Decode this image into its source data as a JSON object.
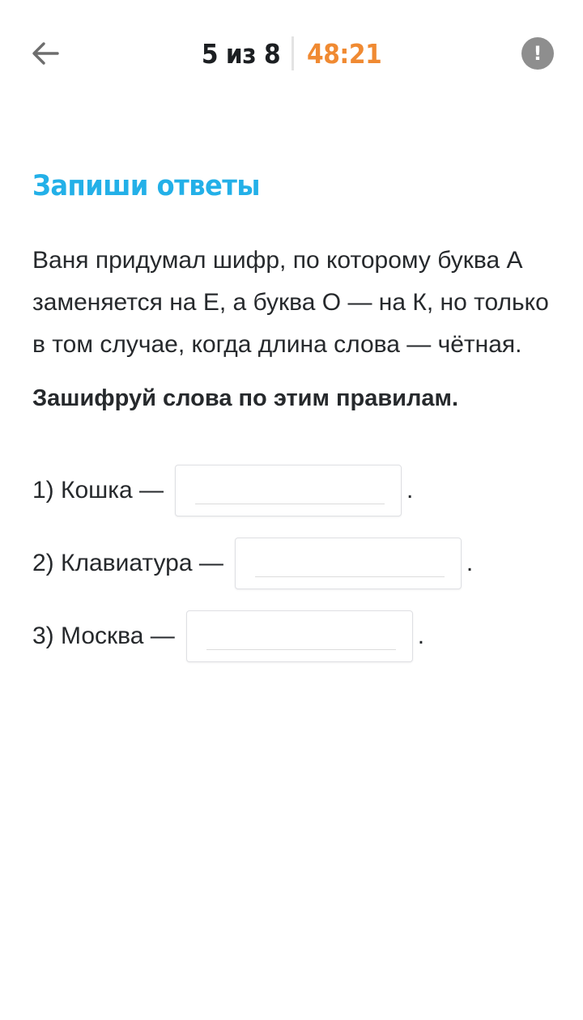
{
  "header": {
    "progress": "5 из 8",
    "timer": "48:21"
  },
  "task": {
    "title": "Запиши ответы",
    "text": "Ваня придумал шифр, по которому буква А заменяется на Е, а буква О — на К, но только в том случае, когда длина слова — чётная.",
    "instruction": "Зашифруй слова по этим правилам."
  },
  "answers": [
    {
      "label": "1) Кошка —",
      "value": "",
      "suffix": "."
    },
    {
      "label": "2) Клавиатура —",
      "value": "",
      "suffix": "."
    },
    {
      "label": "3) Москва —",
      "value": "",
      "suffix": "."
    }
  ],
  "icons": {
    "back": "arrow-left-icon",
    "report": "exclamation-icon"
  },
  "colors": {
    "title": "#23b0e8",
    "timer": "#f08a32",
    "report_button": "#8e8e8e"
  }
}
